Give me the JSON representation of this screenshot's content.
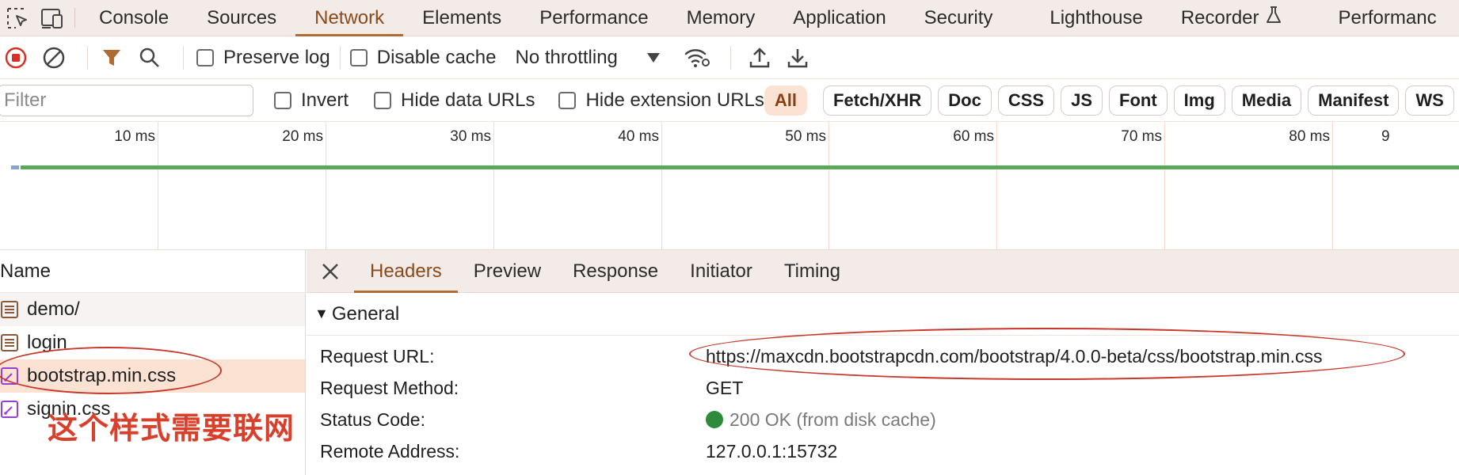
{
  "tabs": [
    {
      "label": "Console"
    },
    {
      "label": "Sources"
    },
    {
      "label": "Network",
      "active": true
    },
    {
      "label": "Elements"
    },
    {
      "label": "Performance"
    },
    {
      "label": "Memory"
    },
    {
      "label": "Application"
    },
    {
      "label": "Security"
    },
    {
      "label": "Lighthouse"
    },
    {
      "label": "Recorder"
    },
    {
      "label": "Performanc"
    }
  ],
  "toolbar": {
    "preserve_log": "Preserve log",
    "disable_cache": "Disable cache",
    "throttling": "No throttling"
  },
  "filter": {
    "placeholder": "Filter",
    "invert": "Invert",
    "hide_data_urls": "Hide data URLs",
    "hide_extension_urls": "Hide extension URLs",
    "types": [
      "All",
      "Fetch/XHR",
      "Doc",
      "CSS",
      "JS",
      "Font",
      "Img",
      "Media",
      "Manifest",
      "WS"
    ]
  },
  "timeline": {
    "ticks": [
      "10 ms",
      "20 ms",
      "30 ms",
      "40 ms",
      "50 ms",
      "60 ms",
      "70 ms",
      "80 ms",
      "9"
    ]
  },
  "requests": {
    "header": "Name",
    "items": [
      {
        "name": "demo/",
        "type": "document"
      },
      {
        "name": "login",
        "type": "document"
      },
      {
        "name": "bootstrap.min.css",
        "type": "stylesheet",
        "selected": true
      },
      {
        "name": "signin.css",
        "type": "stylesheet"
      }
    ]
  },
  "detail": {
    "tabs": [
      "Headers",
      "Preview",
      "Response",
      "Initiator",
      "Timing"
    ],
    "active_tab": "Headers",
    "section": "General",
    "fields": [
      {
        "key": "Request URL:",
        "value": "https://maxcdn.bootstrapcdn.com/bootstrap/4.0.0-beta/css/bootstrap.min.css"
      },
      {
        "key": "Request Method:",
        "value": "GET"
      },
      {
        "key": "Status Code:",
        "value": "200 OK (from disk cache)"
      },
      {
        "key": "Remote Address:",
        "value": "127.0.0.1:15732"
      }
    ]
  },
  "annotation": {
    "text": "这个样式需要联网"
  },
  "colors": {
    "accent": "#b06a34",
    "status_ok": "#2e8b3c",
    "annotation": "#d9402c"
  }
}
